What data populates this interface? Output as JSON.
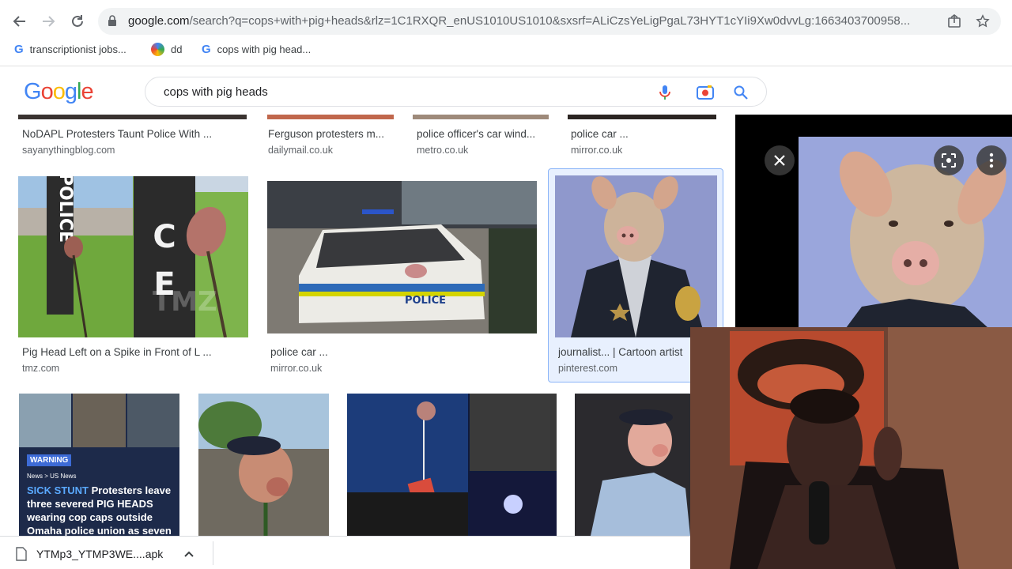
{
  "browser": {
    "url_host": "google.com",
    "url_rest": "/search?q=cops+with+pig+heads&rlz=1C1RXQR_enUS1010US1010&sxsrf=ALiCzsYeLigPgaL73HYT1cYIi9Xw0dvvLg:1663403700958...",
    "bookmarks": [
      {
        "label": "transcriptionist jobs...",
        "icon": "google-g-icon"
      },
      {
        "label": "dd",
        "icon": "color-circle-icon"
      },
      {
        "label": "cops with pig head...",
        "icon": "google-g-icon"
      }
    ]
  },
  "search": {
    "logo_letters": [
      "G",
      "o",
      "o",
      "g",
      "l",
      "e"
    ],
    "query": "cops with pig heads"
  },
  "results": {
    "row1": [
      {
        "caption": "NoDAPL Protesters Taunt Police With ...",
        "source": "sayanythingblog.com"
      },
      {
        "caption": "Ferguson protesters m...",
        "source": "dailymail.co.uk"
      },
      {
        "caption": "police officer's car wind...",
        "source": "metro.co.uk"
      },
      {
        "caption": "police car ...",
        "source": "mirror.co.uk"
      }
    ],
    "row2": [
      {
        "caption": "Pig Head Left on a Spike in Front of L ...",
        "source": "tmz.com",
        "thumb_text": [
          "POLICE",
          "TMZ"
        ]
      },
      {
        "caption": "police car ...",
        "source": "mirror.co.uk",
        "thumb_text": [
          "POLICE"
        ]
      },
      {
        "caption": "journalist... | Cartoon artist",
        "source": "pinterest.com"
      }
    ],
    "row3_headline": {
      "badge": "WARNING",
      "crumb": "News > US News",
      "headline_red": "SICK STUNT",
      "headline_rest": "Protesters leave three severed PIG HEADS wearing cop caps outside Omaha police union as seven"
    }
  },
  "downloads": {
    "file_name": "YTMp3_YTMP3WE....apk"
  },
  "colors": {
    "accent_blue": "#4285f4",
    "red": "#ea4335",
    "link_gray": "#5f6368"
  }
}
